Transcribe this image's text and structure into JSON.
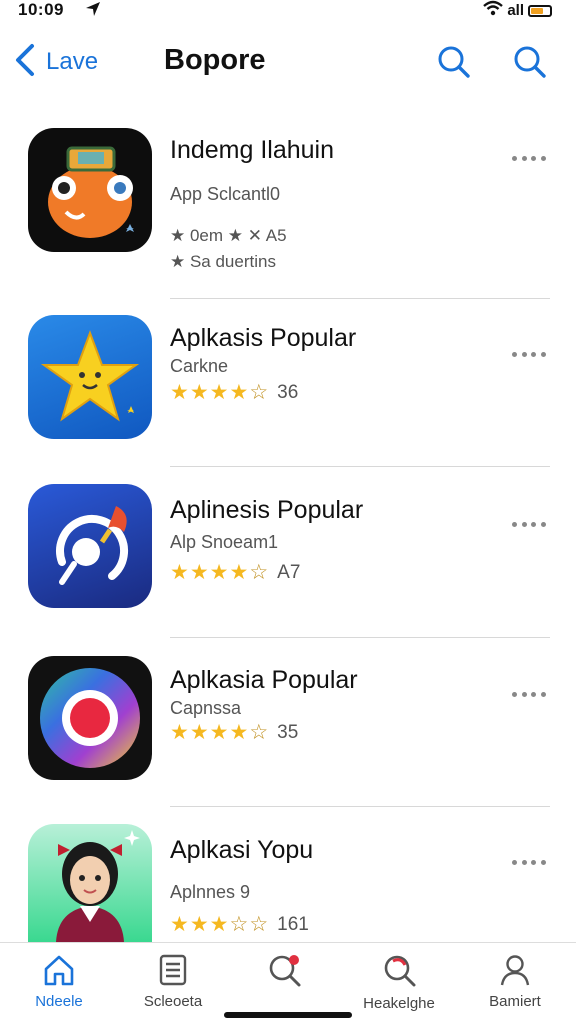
{
  "status": {
    "time": "10:09",
    "carrier": "all"
  },
  "nav": {
    "back_label": "Lave",
    "title": "Bopore"
  },
  "apps": [
    {
      "title": "Indemg Ilahuin",
      "subtitle": "App Sclcantl0",
      "meta1": "★ 0em ★ ✕ A5",
      "meta2": "★ Sa duertins",
      "rating": null,
      "count": ""
    },
    {
      "title": "Aplkasis Popular",
      "subtitle": "Carkne",
      "rating": 4.5,
      "count": "36"
    },
    {
      "title": "Aplinesis Popular",
      "subtitle": "Alp Snoeam1",
      "rating": 4.5,
      "count": "A7"
    },
    {
      "title": "Aplkasia Popular",
      "subtitle": "Capnssa",
      "rating": 4.5,
      "count": "35"
    },
    {
      "title": "Aplkasi Yopu",
      "subtitle": "Aplnnes 9",
      "rating": 3.5,
      "count": "161"
    }
  ],
  "tabs": [
    {
      "label": "Ndeele",
      "icon": "home-icon",
      "active": true
    },
    {
      "label": "Scleoeta",
      "icon": "list-icon",
      "active": false
    },
    {
      "label": "",
      "icon": "search-badge-icon",
      "active": false
    },
    {
      "label": "Heakelghe",
      "icon": "search-alt-icon",
      "active": false
    },
    {
      "label": "Bamiert",
      "icon": "profile-icon",
      "active": false
    }
  ],
  "colors": {
    "accent": "#1a73d9",
    "star": "#f5b820"
  }
}
